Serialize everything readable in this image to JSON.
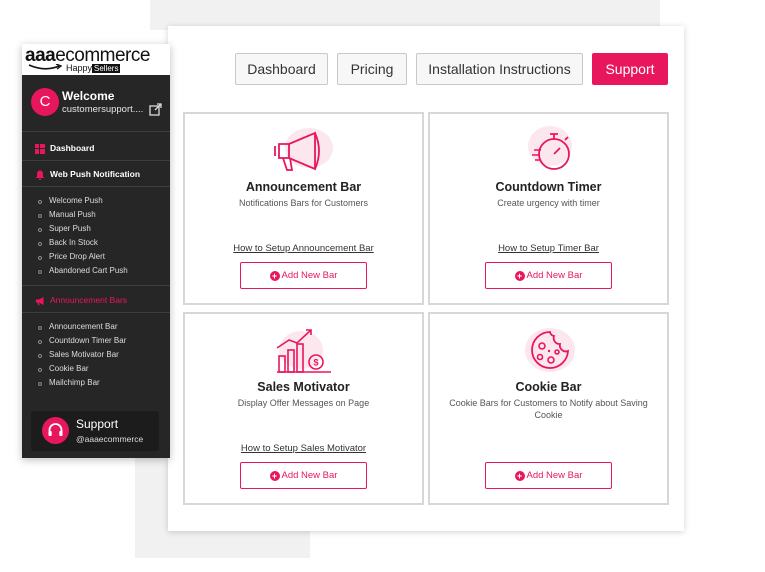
{
  "brand": {
    "logo_main_bold": "aaa",
    "logo_main_rest": "ecommerce",
    "logo_sub_1": "Happy",
    "logo_sub_2": "Sellers",
    "accent_color": "#e8175d",
    "sidebar_color": "#262626"
  },
  "sidebar": {
    "avatar_letter": "C",
    "welcome_title": "Welcome",
    "welcome_email": "customersupport....",
    "dashboard_label": "Dashboard",
    "web_push_label": "Web Push Notification",
    "web_push_items": [
      "Welcome Push",
      "Manual Push",
      "Super Push",
      "Back In Stock",
      "Price Drop Alert",
      "Abandoned Cart Push"
    ],
    "announcement_label": "Announcement Bars",
    "announcement_items": [
      "Announcement Bar",
      "Countdown Timer Bar",
      "Sales Motivator Bar",
      "Cookie Bar",
      "Mailchimp Bar"
    ],
    "support_title": "Support",
    "support_handle": "@aaaecommerce"
  },
  "topnav": {
    "dashboard": "Dashboard",
    "pricing": "Pricing",
    "installation": "Installation Instructions",
    "support": "Support"
  },
  "cards": [
    {
      "title": "Announcement Bar",
      "desc": "Notifications Bars for Customers",
      "howto": "How to Setup Announcement Bar",
      "button": "Add New Bar",
      "icon": "megaphone-icon"
    },
    {
      "title": "Countdown Timer",
      "desc": "Create urgency with timer",
      "howto": "How to Setup Timer Bar",
      "button": "Add New Bar",
      "icon": "stopwatch-icon"
    },
    {
      "title": "Sales Motivator",
      "desc": "Display Offer Messages on Page",
      "howto": "How to Setup Sales Motivator",
      "button": "Add New Bar",
      "icon": "growth-chart-icon"
    },
    {
      "title": "Cookie Bar",
      "desc": "Cookie Bars for Customers to Notify about Saving Cookie",
      "howto": "",
      "button": "Add New Bar",
      "icon": "cookie-icon"
    }
  ]
}
